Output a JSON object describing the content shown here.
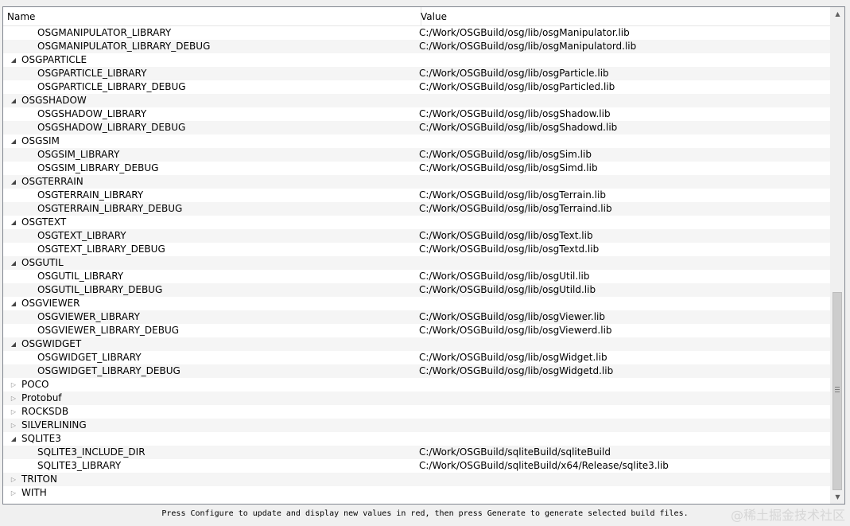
{
  "header": {
    "name_label": "Name",
    "value_label": "Value"
  },
  "rows": [
    {
      "level": 1,
      "name": "OSGMANIPULATOR_LIBRARY",
      "value": "C:/Work/OSGBuild/osg/lib/osgManipulator.lib"
    },
    {
      "level": 1,
      "name": "OSGMANIPULATOR_LIBRARY_DEBUG",
      "value": "C:/Work/OSGBuild/osg/lib/osgManipulatord.lib"
    },
    {
      "level": 0,
      "name": "OSGPARTICLE",
      "expanded": true
    },
    {
      "level": 1,
      "name": "OSGPARTICLE_LIBRARY",
      "value": "C:/Work/OSGBuild/osg/lib/osgParticle.lib"
    },
    {
      "level": 1,
      "name": "OSGPARTICLE_LIBRARY_DEBUG",
      "value": "C:/Work/OSGBuild/osg/lib/osgParticled.lib"
    },
    {
      "level": 0,
      "name": "OSGSHADOW",
      "expanded": true
    },
    {
      "level": 1,
      "name": "OSGSHADOW_LIBRARY",
      "value": "C:/Work/OSGBuild/osg/lib/osgShadow.lib"
    },
    {
      "level": 1,
      "name": "OSGSHADOW_LIBRARY_DEBUG",
      "value": "C:/Work/OSGBuild/osg/lib/osgShadowd.lib"
    },
    {
      "level": 0,
      "name": "OSGSIM",
      "expanded": true
    },
    {
      "level": 1,
      "name": "OSGSIM_LIBRARY",
      "value": "C:/Work/OSGBuild/osg/lib/osgSim.lib"
    },
    {
      "level": 1,
      "name": "OSGSIM_LIBRARY_DEBUG",
      "value": "C:/Work/OSGBuild/osg/lib/osgSimd.lib"
    },
    {
      "level": 0,
      "name": "OSGTERRAIN",
      "expanded": true
    },
    {
      "level": 1,
      "name": "OSGTERRAIN_LIBRARY",
      "value": "C:/Work/OSGBuild/osg/lib/osgTerrain.lib"
    },
    {
      "level": 1,
      "name": "OSGTERRAIN_LIBRARY_DEBUG",
      "value": "C:/Work/OSGBuild/osg/lib/osgTerraind.lib"
    },
    {
      "level": 0,
      "name": "OSGTEXT",
      "expanded": true
    },
    {
      "level": 1,
      "name": "OSGTEXT_LIBRARY",
      "value": "C:/Work/OSGBuild/osg/lib/osgText.lib"
    },
    {
      "level": 1,
      "name": "OSGTEXT_LIBRARY_DEBUG",
      "value": "C:/Work/OSGBuild/osg/lib/osgTextd.lib"
    },
    {
      "level": 0,
      "name": "OSGUTIL",
      "expanded": true
    },
    {
      "level": 1,
      "name": "OSGUTIL_LIBRARY",
      "value": "C:/Work/OSGBuild/osg/lib/osgUtil.lib"
    },
    {
      "level": 1,
      "name": "OSGUTIL_LIBRARY_DEBUG",
      "value": "C:/Work/OSGBuild/osg/lib/osgUtild.lib"
    },
    {
      "level": 0,
      "name": "OSGVIEWER",
      "expanded": true
    },
    {
      "level": 1,
      "name": "OSGVIEWER_LIBRARY",
      "value": "C:/Work/OSGBuild/osg/lib/osgViewer.lib"
    },
    {
      "level": 1,
      "name": "OSGVIEWER_LIBRARY_DEBUG",
      "value": "C:/Work/OSGBuild/osg/lib/osgViewerd.lib"
    },
    {
      "level": 0,
      "name": "OSGWIDGET",
      "expanded": true
    },
    {
      "level": 1,
      "name": "OSGWIDGET_LIBRARY",
      "value": "C:/Work/OSGBuild/osg/lib/osgWidget.lib"
    },
    {
      "level": 1,
      "name": "OSGWIDGET_LIBRARY_DEBUG",
      "value": "C:/Work/OSGBuild/osg/lib/osgWidgetd.lib"
    },
    {
      "level": 0,
      "name": "POCO",
      "expanded": false
    },
    {
      "level": 0,
      "name": "Protobuf",
      "expanded": false
    },
    {
      "level": 0,
      "name": "ROCKSDB",
      "expanded": false
    },
    {
      "level": 0,
      "name": "SILVERLINING",
      "expanded": false
    },
    {
      "level": 0,
      "name": "SQLITE3",
      "expanded": true
    },
    {
      "level": 1,
      "name": "SQLITE3_INCLUDE_DIR",
      "value": "C:/Work/OSGBuild/sqliteBuild/sqliteBuild"
    },
    {
      "level": 1,
      "name": "SQLITE3_LIBRARY",
      "value": "C:/Work/OSGBuild/sqliteBuild/x64/Release/sqlite3.lib"
    },
    {
      "level": 0,
      "name": "TRITON",
      "expanded": false
    },
    {
      "level": 0,
      "name": "WITH",
      "expanded": false
    }
  ],
  "status_text": "Press Configure to update and display new values in red, then press Generate to generate selected build files.",
  "watermark": "@稀土掘金技术社区",
  "icons": {
    "expanded": "triangle-down-icon",
    "collapsed": "triangle-right-icon",
    "scroll_up": "arrow-up-icon",
    "scroll_down": "arrow-down-icon"
  }
}
